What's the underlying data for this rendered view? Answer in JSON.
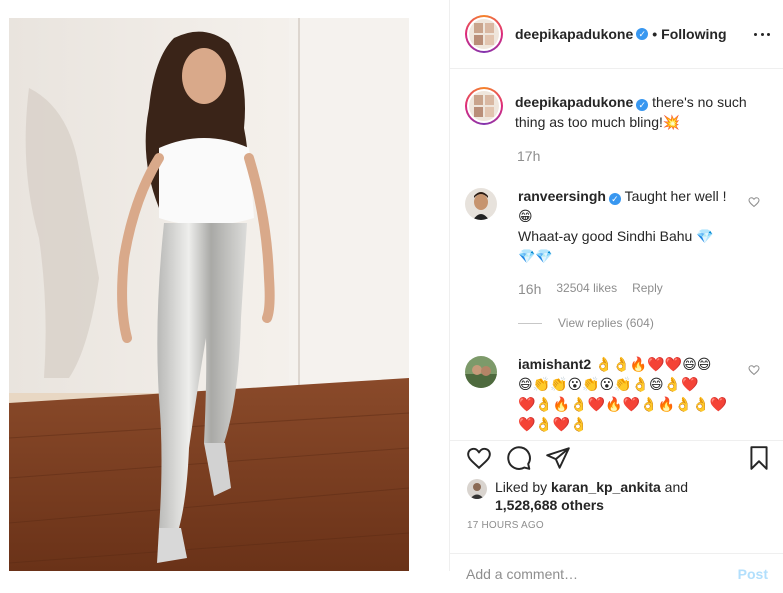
{
  "post": {
    "username": "deepikapadukone",
    "follow_status": "Following",
    "caption": "there's no such thing as too much bling!💥",
    "caption_time": "17h"
  },
  "comments": [
    {
      "username": "ranveersingh",
      "verified": true,
      "text_line1": "Taught her well !",
      "text_line2": "😁",
      "text_line3": "Whaat-ay good Sindhi Bahu 💎",
      "text_line4": "💎💎",
      "time": "16h",
      "likes": "32504 likes",
      "reply_label": "Reply",
      "view_replies": "View replies (604)"
    },
    {
      "username": "iamishant2",
      "verified": false,
      "text_line1": "👌👌🔥❤️❤️😄😄",
      "text_line2": "😄👏👏😮👏😮👏👌😄👌❤️",
      "text_line3": "❤️👌🔥👌❤️🔥❤️👌🔥👌👌❤️",
      "text_line4": "❤️👌❤️👌"
    }
  ],
  "likes": {
    "prefix": "Liked by",
    "user": "karan_kp_ankita",
    "connector": "and",
    "count": "1,528,688 others"
  },
  "timestamp": "17 HOURS AGO",
  "add_comment": {
    "placeholder": "Add a comment…",
    "post_label": "Post"
  },
  "colors": {
    "verified_blue": "#3897f0",
    "muted_text": "#8e8e8e",
    "post_button_disabled": "#b2dffc"
  },
  "icons": [
    "heart-icon",
    "comment-icon",
    "share-icon",
    "bookmark-icon",
    "more-options-icon",
    "verified-badge-icon"
  ]
}
